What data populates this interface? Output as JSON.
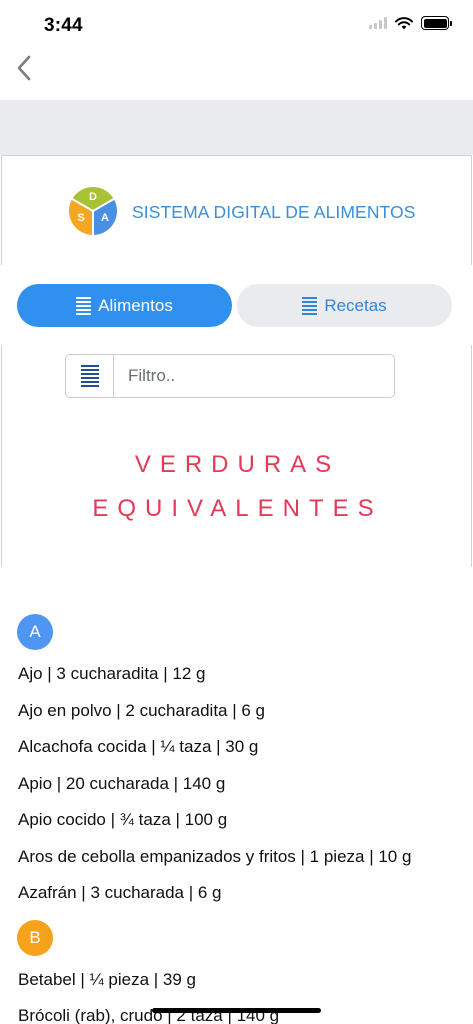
{
  "status_bar": {
    "time": "3:44"
  },
  "logo": {
    "letters": [
      "D",
      "S",
      "A"
    ],
    "title": "SISTEMA DIGITAL DE ALIMENTOS"
  },
  "tabs": [
    {
      "label": "Alimentos",
      "active": true
    },
    {
      "label": "Recetas",
      "active": false
    }
  ],
  "filter": {
    "placeholder": "Filtro.."
  },
  "heading": {
    "line1": "VERDURAS",
    "line2": "EQUIVALENTES"
  },
  "sections": [
    {
      "letter": "A",
      "color": "#4f95f2",
      "items": [
        "Ajo | 3 cucharadita | 12 g",
        "Ajo en polvo | 2 cucharadita | 6 g",
        "Alcachofa cocida | ¼ taza | 30 g",
        "Apio | 20 cucharada | 140 g",
        "Apio cocido | ¾ taza | 100 g",
        "Aros de cebolla empanizados y fritos | 1 pieza | 10 g",
        "Azafrán | 3 cucharada | 6 g"
      ]
    },
    {
      "letter": "B",
      "color": "#f7a21b",
      "items": [
        "Betabel | ¼ pieza | 39 g",
        "Brócoli (rab), crudo | 2 taza | 140 g"
      ]
    }
  ],
  "colors": {
    "accent_blue": "#2f90f0",
    "heading_red": "#e23b5a",
    "logo_text": "#3b8fd6"
  },
  "icons": [
    "back-chevron-icon",
    "signal-icon",
    "wifi-icon",
    "battery-icon",
    "list-icon"
  ]
}
